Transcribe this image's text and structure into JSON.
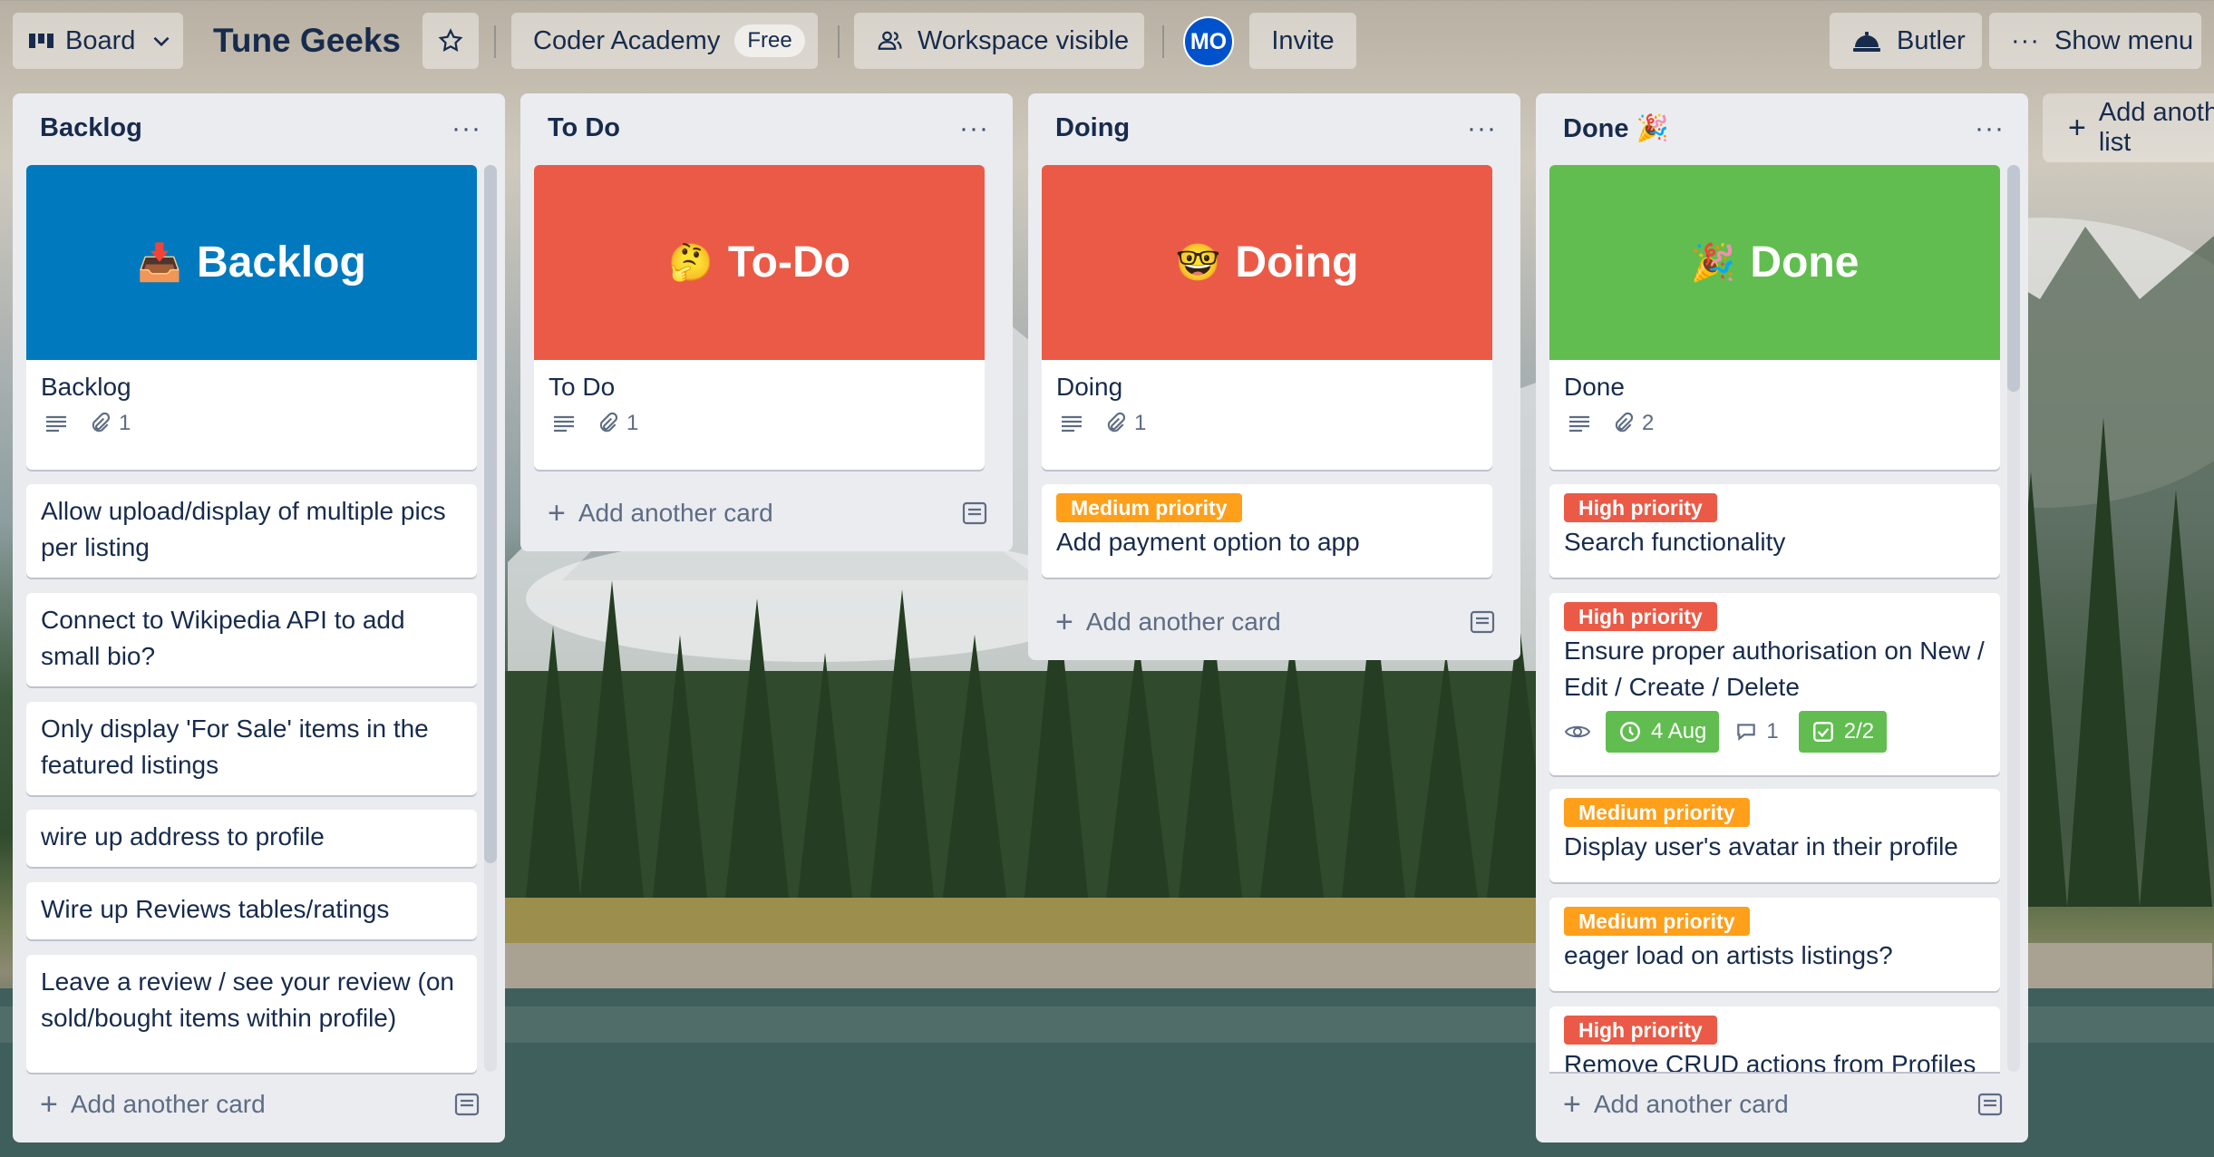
{
  "header": {
    "board_switch_label": "Board",
    "board_title": "Tune Geeks",
    "workspace_name": "Coder Academy",
    "plan_badge": "Free",
    "visibility_label": "Workspace visible",
    "avatar_initials": "MO",
    "invite_label": "Invite",
    "butler_label": "Butler",
    "show_menu_label": "Show menu"
  },
  "add_list_label": "Add another list",
  "lists": [
    {
      "title": "Backlog",
      "add_card_label": "Add another card",
      "cover": {
        "emoji": "📥",
        "text": "Backlog",
        "color": "#0079bf"
      },
      "cover_card": {
        "title": "Backlog",
        "attachments": "1"
      },
      "cards": [
        {
          "title": "Allow upload/display of multiple pics per listing"
        },
        {
          "title": "Connect to Wikipedia API to add small bio?"
        },
        {
          "title": "Only display 'For Sale' items in the featured listings"
        },
        {
          "title": "wire up address to profile"
        },
        {
          "title": "Wire up Reviews tables/ratings"
        },
        {
          "title": "Leave a review / see your review (on sold/bought items within profile)"
        }
      ]
    },
    {
      "title": "To Do",
      "add_card_label": "Add another card",
      "cover": {
        "emoji": "🤔",
        "text": "To-Do",
        "color": "#eb5a46"
      },
      "cover_card": {
        "title": "To Do",
        "attachments": "1"
      }
    },
    {
      "title": "Doing",
      "add_card_label": "Add another card",
      "cover": {
        "emoji": "🤓",
        "text": "Doing",
        "color": "#eb5a46"
      },
      "cover_card": {
        "title": "Doing",
        "attachments": "1"
      },
      "cards": [
        {
          "label": "Medium priority",
          "title": "Add payment option to app"
        }
      ]
    },
    {
      "title": "Done 🎉",
      "add_card_label": "Add another card",
      "cover": {
        "emoji": "🎉",
        "text": "Done",
        "color": "#61bd4f"
      },
      "cover_card": {
        "title": "Done",
        "attachments": "2"
      },
      "cards": [
        {
          "label": "High priority",
          "title": "Search functionality"
        },
        {
          "label": "High priority",
          "title": "Ensure proper authorisation on New / Edit / Create / Delete",
          "due": "4 Aug",
          "comments": "1",
          "checklist": "2/2"
        },
        {
          "label": "Medium priority",
          "title": "Display user's avatar in their profile"
        },
        {
          "label": "Medium priority",
          "title": "eager load on artists listings?"
        },
        {
          "label": "High priority",
          "title": "Remove CRUD actions from Profiles"
        }
      ]
    }
  ],
  "colors": {
    "list_bg": "#ebecf0",
    "label_medium": "#ff9f1a",
    "label_high": "#eb5a46",
    "badge_green": "#61bd4f",
    "avatar_blue": "#0052cc"
  }
}
